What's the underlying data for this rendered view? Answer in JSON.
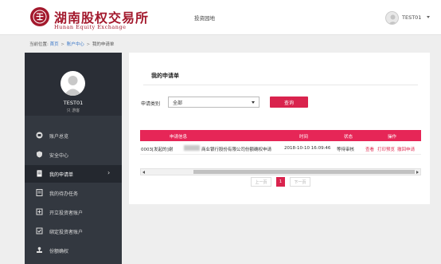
{
  "header": {
    "logo_cn": "湖南股权交易所",
    "logo_en": "Hunan Equity Exchange",
    "nav_link": "投资园地",
    "username": "TEST01"
  },
  "breadcrumb": {
    "prefix": "当前位置:",
    "items": [
      "首页",
      "账户中心",
      "我的申请单"
    ],
    "separator": ">"
  },
  "sidebar": {
    "profile_name": "TEST01",
    "profile_sub": "只 游客",
    "items": [
      {
        "label": "账户总览",
        "icon": "account-overview-icon",
        "active": false
      },
      {
        "label": "安全中心",
        "icon": "shield-icon",
        "active": false
      },
      {
        "label": "我的申请单",
        "icon": "document-icon",
        "active": true
      },
      {
        "label": "我的待办任务",
        "icon": "task-list-icon",
        "active": false
      },
      {
        "label": "开立投资者账户",
        "icon": "open-account-icon",
        "active": false
      },
      {
        "label": "绑定投资者账户",
        "icon": "bind-account-icon",
        "active": false
      },
      {
        "label": "份额确权",
        "icon": "stamp-icon",
        "active": false
      }
    ]
  },
  "panel": {
    "title": "我的申请单",
    "filter_label": "申请类别",
    "filter_value": "全部",
    "query_button": "查询"
  },
  "table": {
    "columns": [
      "申请信息",
      "时间",
      "状态",
      "操作"
    ],
    "rows": [
      {
        "info_prefix": "0003[发起的]谢",
        "info_suffix": "商业银行股份有限公司份额确权申请",
        "time": "2018-10-10 16:09:46",
        "status": "等待审核",
        "actions": [
          "查看",
          "打印预览",
          "撤回申请"
        ]
      }
    ]
  },
  "pagination": {
    "prev": "上一页",
    "current": "1",
    "next": "下一页"
  },
  "colors": {
    "brand_red": "#a3192d",
    "accent": "#e62657",
    "sidebar_bg": "#333840"
  }
}
